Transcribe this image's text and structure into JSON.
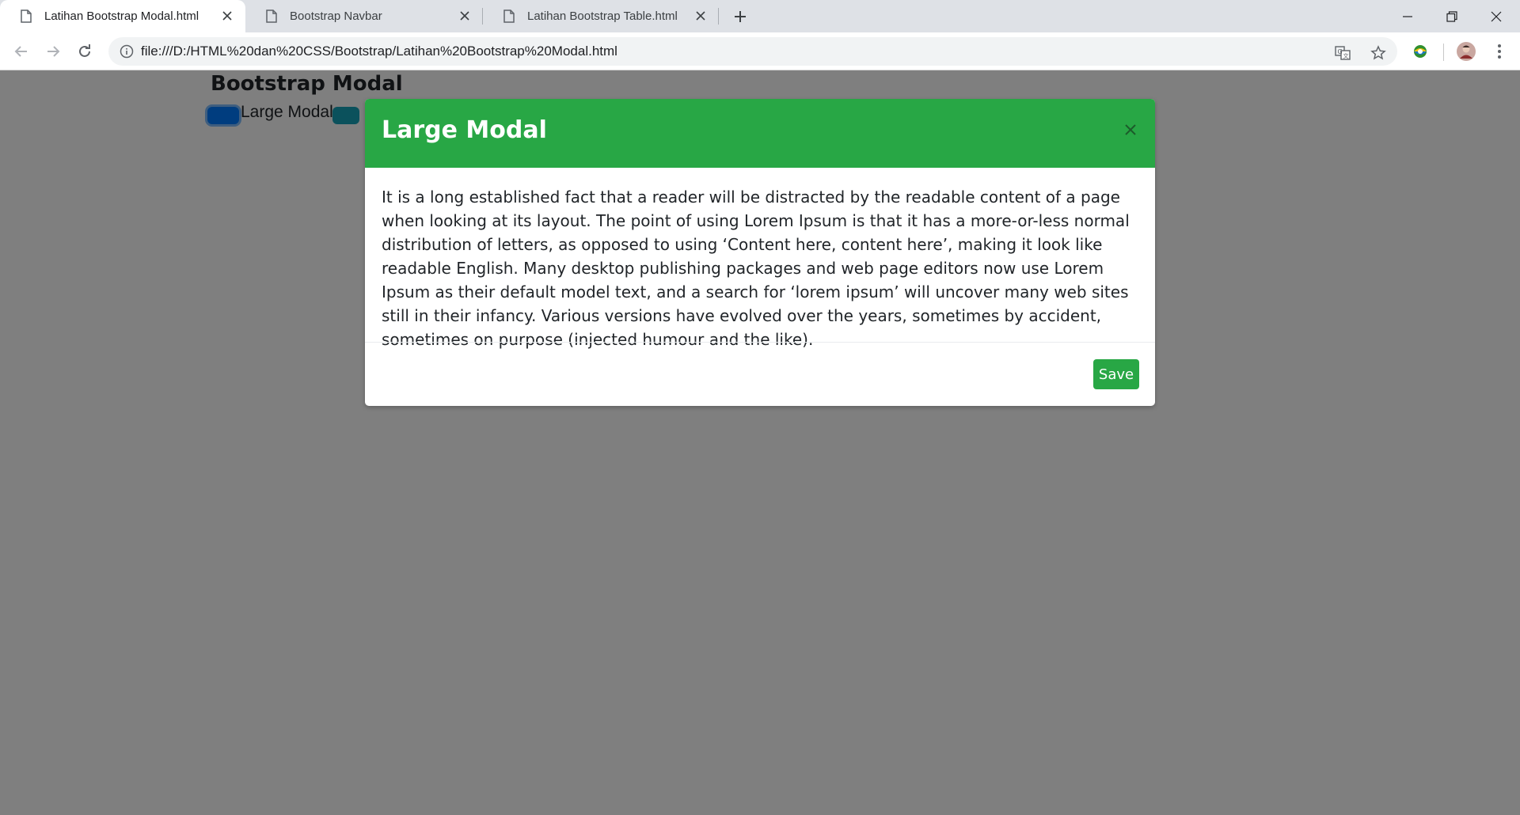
{
  "browser": {
    "tabs": [
      {
        "title": "Latihan Bootstrap Modal.html",
        "active": true
      },
      {
        "title": "Bootstrap Navbar",
        "active": false
      },
      {
        "title": "Latihan Bootstrap Table.html",
        "active": false
      }
    ],
    "url": "file:///D:/HTML%20dan%20CSS/Bootstrap/Latihan%20Bootstrap%20Modal.html"
  },
  "page": {
    "title": "Bootstrap Modal",
    "button_label": "Large Modal"
  },
  "modal": {
    "title": "Large Modal",
    "body": "It is a long established fact that a reader will be distracted by the readable content of a page when looking at its layout. The point of using Lorem Ipsum is that it has a more-or-less normal distribution of letters, as opposed to using ‘Content here, content here’, making it look like readable English. Many desktop publishing packages and web page editors now use Lorem Ipsum as their default model text, and a search for ‘lorem ipsum’ will uncover many web sites still in their infancy. Various versions have evolved over the years, sometimes by accident, sometimes on purpose (injected humour and the like).",
    "save_label": "Save",
    "header_color": "#28a745"
  },
  "colors": {
    "success": "#28a745",
    "info": "#17a2b8",
    "backdrop": "rgba(0,0,0,0.5)"
  },
  "icons": {
    "tab": "document-icon",
    "close": "close-icon",
    "new_tab": "plus-icon",
    "back": "back-arrow-icon",
    "forward": "forward-arrow-icon",
    "reload": "reload-icon",
    "info": "info-icon",
    "translate": "translate-icon",
    "bookmark": "star-icon",
    "extension": "extension-icon",
    "profile": "avatar",
    "menu": "kebab-menu-icon"
  }
}
